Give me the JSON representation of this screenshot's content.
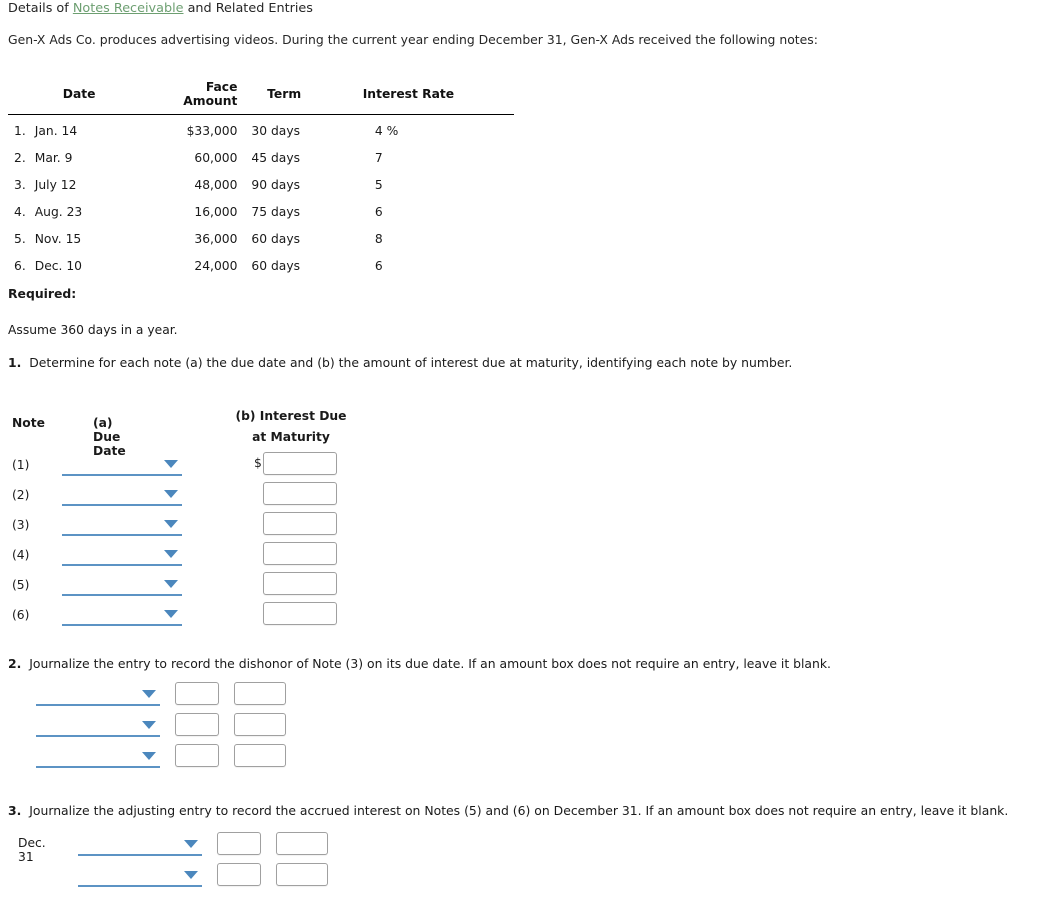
{
  "header": {
    "title_prefix": "Details of ",
    "title_link": "Notes Receivable",
    "title_suffix": " and Related Entries",
    "intro": "Gen-X Ads Co. produces advertising videos. During the current year ending December 31, Gen-X Ads received the following notes:",
    "link_color": "#6d9f71"
  },
  "notes_table": {
    "columns": [
      "",
      "Date",
      "Face Amount",
      "Term",
      "Interest Rate"
    ],
    "rows": [
      {
        "num": "1.",
        "date": "Jan. 14",
        "face": "$33,000",
        "term": "30 days",
        "rate": "4 %"
      },
      {
        "num": "2.",
        "date": "Mar. 9",
        "face": "60,000",
        "term": "45 days",
        "rate": "7"
      },
      {
        "num": "3.",
        "date": "July 12",
        "face": "48,000",
        "term": "90 days",
        "rate": "5"
      },
      {
        "num": "4.",
        "date": "Aug. 23",
        "face": "16,000",
        "term": "75 days",
        "rate": "6"
      },
      {
        "num": "5.",
        "date": "Nov. 15",
        "face": "36,000",
        "term": "60 days",
        "rate": "8"
      },
      {
        "num": "6.",
        "date": "Dec. 10",
        "face": "24,000",
        "term": "60 days",
        "rate": "6"
      }
    ]
  },
  "required": {
    "label": "Required:",
    "assume": "Assume 360 days in a year.",
    "item1_num": "1.",
    "item1_text": "Determine for each note (a) the due date and (b) the amount of interest due at maturity, identifying each note by number.",
    "item2_num": "2.",
    "item2_text": "Journalize the entry to record the dishonor of Note (3) on its due date. If an amount box does not require an entry, leave it blank.",
    "item3_num": "3.",
    "item3_text": "Journalize the adjusting entry to record the accrued interest on Notes (5) and (6) on December 31. If an amount box does not require an entry, leave it blank."
  },
  "part1": {
    "head_note": "Note",
    "head_due_date": "(a) Due Date",
    "head_interest_line1": "(b) Interest Due",
    "head_interest_line2": "at Maturity",
    "dollar_sign": "$",
    "rows": [
      {
        "label": "(1)",
        "due_date_value": "",
        "interest_value": ""
      },
      {
        "label": "(2)",
        "due_date_value": "",
        "interest_value": ""
      },
      {
        "label": "(3)",
        "due_date_value": "",
        "interest_value": ""
      },
      {
        "label": "(4)",
        "due_date_value": "",
        "interest_value": ""
      },
      {
        "label": "(5)",
        "due_date_value": "",
        "interest_value": ""
      },
      {
        "label": "(6)",
        "due_date_value": "",
        "interest_value": ""
      }
    ],
    "caret_icon": "chevron-down-icon"
  },
  "part2": {
    "rows": [
      {
        "account_value": "",
        "debit_value": "",
        "credit_value": ""
      },
      {
        "account_value": "",
        "debit_value": "",
        "credit_value": ""
      },
      {
        "account_value": "",
        "debit_value": "",
        "credit_value": ""
      }
    ]
  },
  "part3": {
    "date_label": "Dec. 31",
    "rows": [
      {
        "account_value": "",
        "debit_value": "",
        "credit_value": ""
      },
      {
        "account_value": "",
        "debit_value": "",
        "credit_value": ""
      }
    ]
  },
  "theme": {
    "accent_blue": "#5c93c4",
    "caret_blue": "#4b87bd",
    "box_border": "#a0a0a0",
    "text": "#1a1a1a"
  }
}
